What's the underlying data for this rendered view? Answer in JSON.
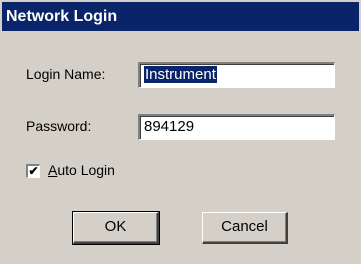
{
  "dialog": {
    "title": "Network Login",
    "login_name_label": "Login Name:",
    "login_name_value": "Instrument",
    "password_label": "Password:",
    "password_value": "894129",
    "auto_login_checked": true,
    "auto_login_label_first": "A",
    "auto_login_label_rest": "uto Login",
    "ok_label": "OK",
    "cancel_label": "Cancel"
  },
  "colors": {
    "title_bar": "#0a246a",
    "dialog_bg": "#d4d0c8",
    "selection": "#0a246a"
  }
}
